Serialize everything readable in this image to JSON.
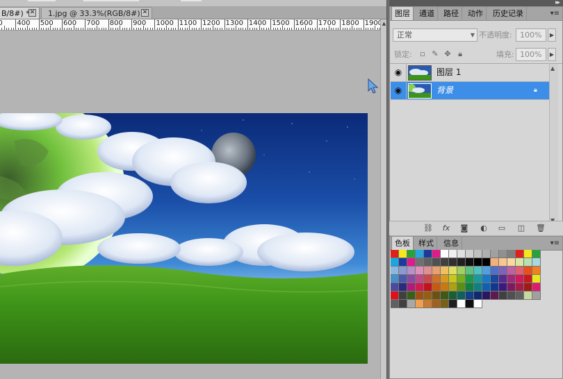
{
  "document_tabs": [
    {
      "label": "B/8#) *",
      "active": true
    },
    {
      "label": "1.jpg @ 33.3%(RGB/8#)",
      "active": false
    }
  ],
  "ruler": {
    "labels": [
      "00",
      "400",
      "500",
      "600",
      "700",
      "800",
      "900",
      "1000",
      "1100",
      "1200",
      "1300",
      "1400",
      "1500",
      "1600",
      "1700",
      "1800",
      "1900"
    ]
  },
  "layers_panel": {
    "tabs": [
      "图层",
      "通道",
      "路径",
      "动作",
      "历史记录"
    ],
    "blend_mode": "正常",
    "opacity_label": "不透明度:",
    "opacity_value": "100%",
    "lock_label": "锁定:",
    "fill_label": "填充:",
    "fill_value": "100%",
    "layers": [
      {
        "name": "图层 1",
        "visible": true,
        "selected": false,
        "locked": false
      },
      {
        "name": "背景",
        "visible": true,
        "selected": true,
        "locked": true
      }
    ],
    "footer_icons": [
      "link-icon",
      "fx-icon",
      "mask-icon",
      "adjustment-icon",
      "group-folder-icon",
      "new-layer-icon",
      "trash-icon"
    ]
  },
  "swatch_panel": {
    "tabs": [
      "色板",
      "样式",
      "信息"
    ],
    "colors": [
      [
        "#e0201a",
        "#f4e81a",
        "#2aa23a",
        "#26a6e0",
        "#1c3a9c",
        "#e01a8a",
        "#ffffff",
        "#f0f0f0",
        "#e0e0e0",
        "#d0d0d0",
        "#c0c0c0",
        "#b0b0b0",
        "#a0a0a0",
        "#909090",
        "#808080",
        "#e0201a",
        "#f4e81a",
        "#2aa23a"
      ],
      [
        "#1aa6e0",
        "#1c3a9c",
        "#e01a8a",
        "#707070",
        "#606060",
        "#505050",
        "#404040",
        "#303030",
        "#202020",
        "#101010",
        "#000000",
        "#000000",
        "#f4b07a",
        "#f8c890",
        "#fad8a0",
        "#d8e8a0",
        "#b8e0b0",
        "#a8d8e0"
      ],
      [
        "#8ab8e0",
        "#8a9ad0",
        "#b890c8",
        "#e090b8",
        "#e09090",
        "#e8a070",
        "#f0c060",
        "#e0e060",
        "#a0d060",
        "#60c080",
        "#50c0c0",
        "#50a0e0",
        "#5070c8",
        "#8060b8",
        "#c060a0",
        "#e06070",
        "#e8501a",
        "#f08020"
      ],
      [
        "#4a90c8",
        "#4a5aa8",
        "#8a4aa0",
        "#c04a88",
        "#c84a4a",
        "#d0702a",
        "#d89a1a",
        "#c8c81a",
        "#78b01a",
        "#1a9a4a",
        "#1a9a9a",
        "#1a78c8",
        "#1a48a0",
        "#5a2a90",
        "#a02a78",
        "#d01a5a",
        "#c81a1a",
        "#e8e81a"
      ],
      [
        "#4a4aa0",
        "#2a2a80",
        "#b01a78",
        "#d01a50",
        "#c8101a",
        "#c85a10",
        "#c87a10",
        "#b0a010",
        "#5a9010",
        "#108040",
        "#108080",
        "#1060b0",
        "#103890",
        "#3a1a80",
        "#801a60",
        "#a81a48",
        "#a01a1a",
        "#e01a70"
      ],
      [
        "#e0101a",
        "#404040",
        "#386018",
        "#a05010",
        "#906010",
        "#705010",
        "#405818",
        "#186030",
        "#106060",
        "#10408a",
        "#102870",
        "#281860",
        "#601850",
        "#404040",
        "#505050",
        "#606060",
        "#c8d8a0",
        "#a0a0a0"
      ],
      [
        "#606060",
        "#404040",
        "#a8a8a8",
        "#f0a050",
        "#c87a30",
        "#a06020",
        "#786018",
        "#202020",
        "#ffffff",
        "#101010",
        "#ffffff"
      ]
    ]
  }
}
